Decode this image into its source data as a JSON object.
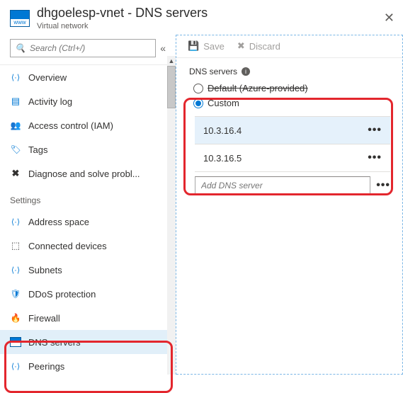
{
  "header": {
    "title": "dhgoelesp-vnet - DNS servers",
    "subtitle": "Virtual network"
  },
  "search": {
    "placeholder": "Search (Ctrl+/)"
  },
  "nav": {
    "items": {
      "overview": "Overview",
      "activity": "Activity log",
      "iam": "Access control (IAM)",
      "tags": "Tags",
      "diagnose": "Diagnose and solve probl..."
    },
    "section_settings": "Settings",
    "settings": {
      "address": "Address space",
      "devices": "Connected devices",
      "subnets": "Subnets",
      "ddos": "DDoS protection",
      "firewall": "Firewall",
      "dns": "DNS servers",
      "peerings": "Peerings"
    }
  },
  "toolbar": {
    "save": "Save",
    "discard": "Discard"
  },
  "panel": {
    "section_label": "DNS servers",
    "option_default": "Default (Azure-provided)",
    "option_custom": "Custom",
    "servers": [
      "10.3.16.4",
      "10.3.16.5"
    ],
    "add_placeholder": "Add DNS server"
  }
}
